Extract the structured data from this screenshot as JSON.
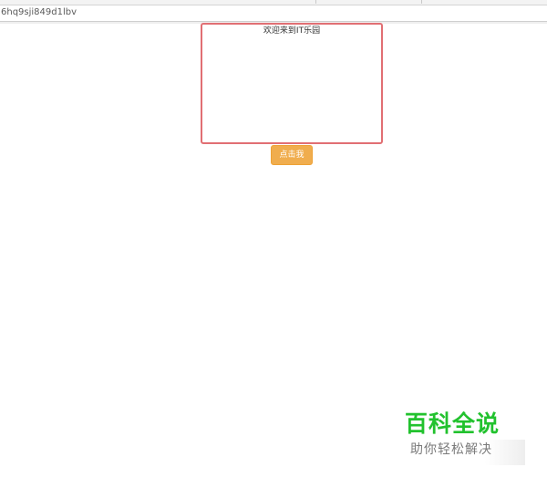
{
  "browser": {
    "url": "6hq9sji849d1lbv"
  },
  "demo": {
    "welcome_text": "欢迎来到IT乐园",
    "button_label": "点击我"
  },
  "watermark": {
    "title": "百科全说",
    "subtitle": "助你轻松解决"
  },
  "colors": {
    "box_border": "#e16f73",
    "button_bg": "#f0ad4e",
    "watermark_title": "#22c22e",
    "watermark_subtitle": "#7a7a7a"
  }
}
